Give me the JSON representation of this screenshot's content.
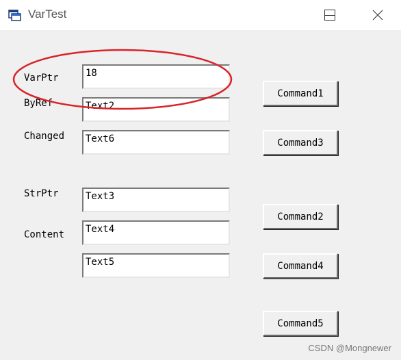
{
  "window": {
    "title": "VarTest",
    "app_icon": "app-window-icon"
  },
  "labels": {
    "varptr": "VarPtr",
    "byref": "ByRef",
    "changed": "Changed",
    "strptr": "StrPtr",
    "content": "Content"
  },
  "textboxes": {
    "varptr": "18",
    "byref": "Text2",
    "changed": "Text6",
    "strptr": "Text3",
    "content": "Text4",
    "extra": "Text5"
  },
  "buttons": {
    "command1": "Command1",
    "command3": "Command3",
    "command2": "Command2",
    "command4": "Command4",
    "command5": "Command5"
  },
  "annotation": {
    "color": "#d9232a"
  },
  "watermark": "CSDN @Mongnewer"
}
